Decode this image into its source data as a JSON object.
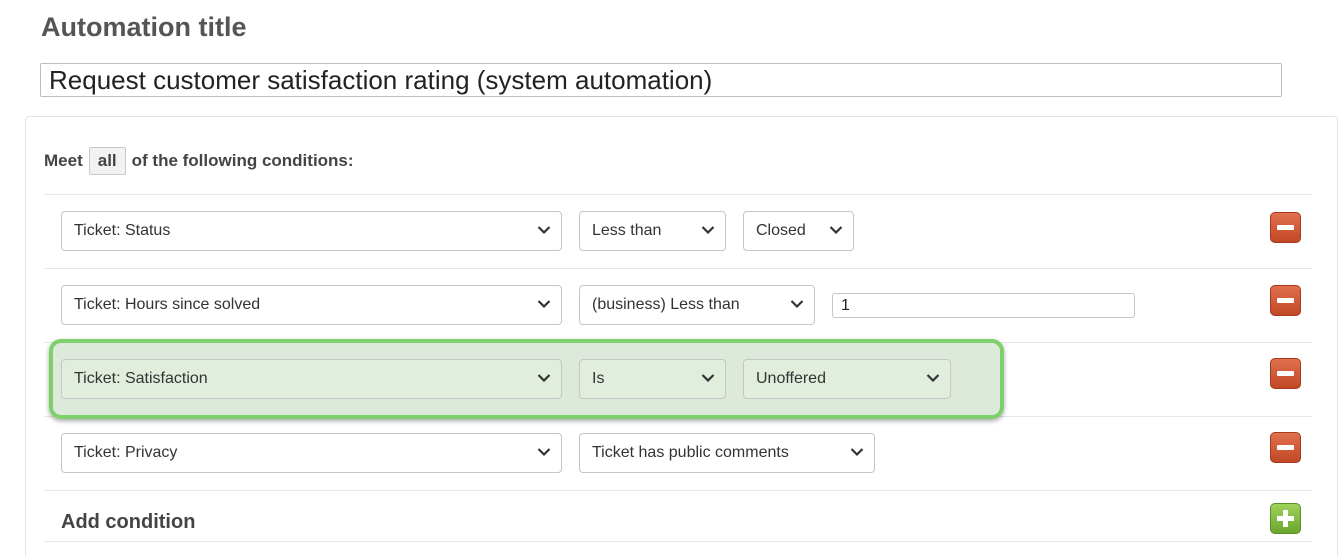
{
  "automation": {
    "title_label": "Automation title",
    "title_value": "Request customer satisfaction rating (system automation)"
  },
  "conditions": {
    "meet_prefix": "Meet",
    "meet_mode": "all",
    "meet_suffix": "of the following conditions:",
    "rows": [
      {
        "field": "Ticket: Status",
        "operator": "Less than",
        "value": "Closed",
        "value_type": "select",
        "highlighted": false
      },
      {
        "field": "Ticket: Hours since solved",
        "operator": "(business) Less than",
        "value": "1",
        "value_type": "text",
        "highlighted": false
      },
      {
        "field": "Ticket: Satisfaction",
        "operator": "Is",
        "value": "Unoffered",
        "value_type": "select",
        "highlighted": true
      },
      {
        "field": "Ticket: Privacy",
        "operator": "Ticket has public comments",
        "value": "",
        "value_type": "none",
        "highlighted": false
      }
    ],
    "add_label": "Add condition"
  },
  "icons": {
    "dropdown": "chevron-down-icon",
    "remove": "minus-icon",
    "add": "plus-icon"
  },
  "colors": {
    "remove_button": "#c94f2b",
    "add_button": "#7cb342",
    "highlight_border": "#7ed16a"
  }
}
